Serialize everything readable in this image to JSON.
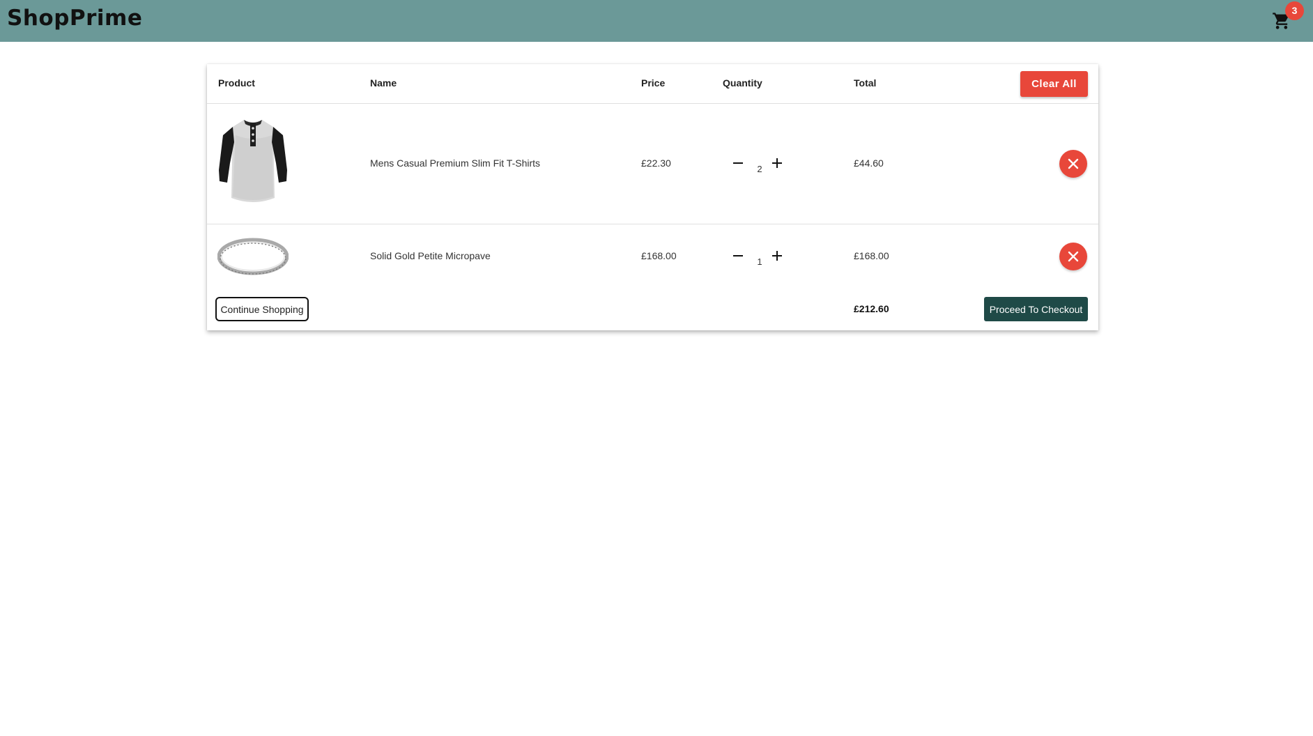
{
  "header": {
    "brand": "ShopPrime",
    "cart_count": "3",
    "cart_icon": "shopping-cart-icon",
    "background": "#6b9998"
  },
  "table": {
    "columns": [
      "Product",
      "Name",
      "Price",
      "Quantity",
      "Total"
    ],
    "clear_all_label": "Clear All",
    "rows": [
      {
        "image": "tshirt-product-image",
        "name": "Mens Casual Premium Slim Fit T-Shirts",
        "price": "£22.30",
        "quantity": "2",
        "total": "£44.60"
      },
      {
        "image": "ring-product-image",
        "name": "Solid Gold Petite Micropave",
        "price": "£168.00",
        "quantity": "1",
        "total": "£168.00"
      }
    ]
  },
  "footer": {
    "continue_label": "Continue Shopping",
    "grand_total": "£212.60",
    "checkout_label": "Proceed To Checkout"
  },
  "colors": {
    "accent_red": "#e8473a",
    "checkout_green": "#1f4a47"
  }
}
